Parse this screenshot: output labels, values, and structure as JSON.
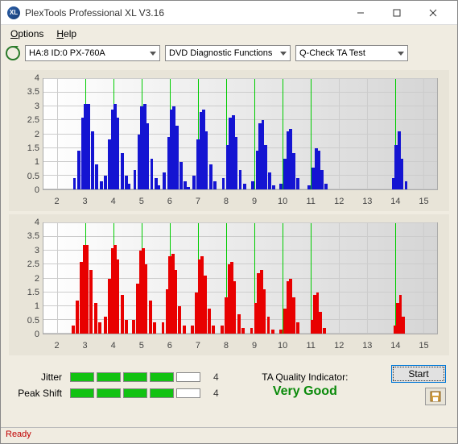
{
  "window": {
    "title": "PlexTools Professional XL V3.16"
  },
  "menu": {
    "options": "Options",
    "help": "Help"
  },
  "toolbar": {
    "device": "HA:8 ID:0   PX-760A",
    "functions": "DVD Diagnostic Functions",
    "test": "Q-Check TA Test"
  },
  "chart_data": [
    {
      "type": "bar",
      "color": "#1414d2",
      "xlim": [
        1.5,
        15.5
      ],
      "ylim": [
        0,
        4
      ],
      "yticks": [
        0,
        0.5,
        1,
        1.5,
        2,
        2.5,
        3,
        3.5,
        4
      ],
      "xticks": [
        2,
        3,
        4,
        5,
        6,
        7,
        8,
        9,
        10,
        11,
        12,
        13,
        14,
        15
      ],
      "markers": [
        3,
        4,
        5,
        6,
        7,
        8,
        9,
        10,
        11,
        14
      ],
      "bars": [
        [
          2.6,
          0.4
        ],
        [
          2.75,
          1.4
        ],
        [
          2.9,
          2.6
        ],
        [
          3.0,
          3.1
        ],
        [
          3.1,
          3.1
        ],
        [
          3.25,
          2.1
        ],
        [
          3.4,
          0.9
        ],
        [
          3.55,
          0.3
        ],
        [
          3.7,
          0.5
        ],
        [
          3.85,
          1.8
        ],
        [
          3.95,
          2.9
        ],
        [
          4.05,
          3.1
        ],
        [
          4.15,
          2.6
        ],
        [
          4.3,
          1.3
        ],
        [
          4.45,
          0.5
        ],
        [
          4.55,
          0.2
        ],
        [
          4.75,
          0.7
        ],
        [
          4.9,
          2.0
        ],
        [
          5.0,
          3.0
        ],
        [
          5.1,
          3.1
        ],
        [
          5.2,
          2.4
        ],
        [
          5.35,
          1.1
        ],
        [
          5.5,
          0.4
        ],
        [
          5.6,
          0.15
        ],
        [
          5.8,
          0.6
        ],
        [
          5.95,
          1.9
        ],
        [
          6.05,
          2.9
        ],
        [
          6.15,
          3.0
        ],
        [
          6.25,
          2.3
        ],
        [
          6.4,
          1.0
        ],
        [
          6.55,
          0.3
        ],
        [
          6.65,
          0.1
        ],
        [
          6.85,
          0.5
        ],
        [
          7.0,
          1.8
        ],
        [
          7.1,
          2.8
        ],
        [
          7.2,
          2.9
        ],
        [
          7.3,
          2.1
        ],
        [
          7.45,
          0.9
        ],
        [
          7.6,
          0.3
        ],
        [
          7.9,
          0.4
        ],
        [
          8.05,
          1.6
        ],
        [
          8.15,
          2.6
        ],
        [
          8.25,
          2.7
        ],
        [
          8.35,
          1.9
        ],
        [
          8.5,
          0.7
        ],
        [
          8.65,
          0.2
        ],
        [
          8.95,
          0.3
        ],
        [
          9.1,
          1.4
        ],
        [
          9.2,
          2.4
        ],
        [
          9.3,
          2.5
        ],
        [
          9.4,
          1.6
        ],
        [
          9.55,
          0.6
        ],
        [
          9.7,
          0.15
        ],
        [
          9.95,
          0.2
        ],
        [
          10.1,
          1.1
        ],
        [
          10.2,
          2.1
        ],
        [
          10.3,
          2.2
        ],
        [
          10.4,
          1.3
        ],
        [
          10.55,
          0.4
        ],
        [
          10.95,
          0.15
        ],
        [
          11.1,
          0.8
        ],
        [
          11.2,
          1.5
        ],
        [
          11.3,
          1.4
        ],
        [
          11.4,
          0.7
        ],
        [
          11.55,
          0.2
        ],
        [
          13.95,
          0.4
        ],
        [
          14.05,
          1.6
        ],
        [
          14.15,
          2.1
        ],
        [
          14.25,
          1.1
        ],
        [
          14.4,
          0.3
        ]
      ]
    },
    {
      "type": "bar",
      "color": "#e80000",
      "xlim": [
        1.5,
        15.5
      ],
      "ylim": [
        0,
        4
      ],
      "yticks": [
        0,
        0.5,
        1,
        1.5,
        2,
        2.5,
        3,
        3.5,
        4
      ],
      "xticks": [
        2,
        3,
        4,
        5,
        6,
        7,
        8,
        9,
        10,
        11,
        12,
        13,
        14,
        15
      ],
      "markers": [
        3,
        4,
        5,
        6,
        7,
        8,
        9,
        10,
        11,
        14
      ],
      "bars": [
        [
          2.55,
          0.3
        ],
        [
          2.7,
          1.2
        ],
        [
          2.85,
          2.6
        ],
        [
          2.95,
          3.2
        ],
        [
          3.05,
          3.2
        ],
        [
          3.2,
          2.3
        ],
        [
          3.35,
          1.1
        ],
        [
          3.5,
          0.4
        ],
        [
          3.7,
          0.6
        ],
        [
          3.85,
          2.0
        ],
        [
          3.95,
          3.1
        ],
        [
          4.05,
          3.2
        ],
        [
          4.15,
          2.7
        ],
        [
          4.3,
          1.4
        ],
        [
          4.45,
          0.5
        ],
        [
          4.7,
          0.5
        ],
        [
          4.85,
          1.8
        ],
        [
          4.95,
          3.0
        ],
        [
          5.05,
          3.1
        ],
        [
          5.15,
          2.5
        ],
        [
          5.3,
          1.2
        ],
        [
          5.45,
          0.4
        ],
        [
          5.75,
          0.4
        ],
        [
          5.9,
          1.6
        ],
        [
          6.0,
          2.8
        ],
        [
          6.1,
          2.9
        ],
        [
          6.2,
          2.3
        ],
        [
          6.35,
          1.0
        ],
        [
          6.5,
          0.3
        ],
        [
          6.8,
          0.3
        ],
        [
          6.95,
          1.5
        ],
        [
          7.05,
          2.7
        ],
        [
          7.15,
          2.8
        ],
        [
          7.25,
          2.1
        ],
        [
          7.4,
          0.9
        ],
        [
          7.55,
          0.3
        ],
        [
          7.85,
          0.3
        ],
        [
          8.0,
          1.3
        ],
        [
          8.1,
          2.5
        ],
        [
          8.2,
          2.6
        ],
        [
          8.3,
          1.9
        ],
        [
          8.45,
          0.7
        ],
        [
          8.6,
          0.2
        ],
        [
          8.9,
          0.2
        ],
        [
          9.05,
          1.1
        ],
        [
          9.15,
          2.2
        ],
        [
          9.25,
          2.3
        ],
        [
          9.35,
          1.6
        ],
        [
          9.5,
          0.6
        ],
        [
          9.65,
          0.15
        ],
        [
          9.95,
          0.15
        ],
        [
          10.1,
          0.9
        ],
        [
          10.2,
          1.9
        ],
        [
          10.3,
          2.0
        ],
        [
          10.4,
          1.3
        ],
        [
          10.55,
          0.4
        ],
        [
          11.05,
          0.5
        ],
        [
          11.15,
          1.4
        ],
        [
          11.25,
          1.5
        ],
        [
          11.35,
          0.8
        ],
        [
          11.5,
          0.2
        ],
        [
          14.0,
          0.3
        ],
        [
          14.1,
          1.1
        ],
        [
          14.2,
          1.4
        ],
        [
          14.3,
          0.6
        ]
      ]
    }
  ],
  "meters": {
    "jitter": {
      "label": "Jitter",
      "value": "4",
      "filled": 4,
      "total": 5
    },
    "peakshift": {
      "label": "Peak Shift",
      "value": "4",
      "filled": 4,
      "total": 5
    }
  },
  "quality": {
    "label": "TA Quality Indicator:",
    "value": "Very Good"
  },
  "buttons": {
    "start": "Start"
  },
  "status": {
    "text": "Ready"
  }
}
